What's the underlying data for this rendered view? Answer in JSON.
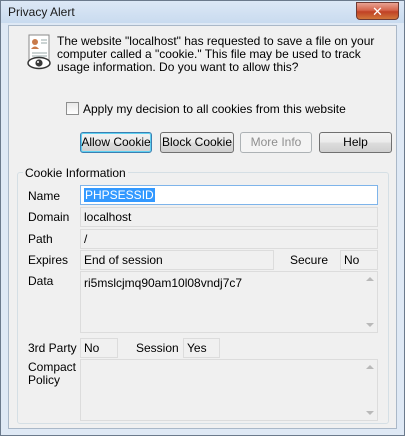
{
  "window": {
    "title": "Privacy Alert",
    "close_glyph": "✕"
  },
  "message": "The website \"localhost\" has requested to save a file on your computer called a \"cookie.\"  This file may be used to track usage information. Do you want to allow this?",
  "apply_checkbox": {
    "label": "Apply my decision to all cookies from this website",
    "checked": false
  },
  "buttons": {
    "allow": "Allow Cookie",
    "block": "Block Cookie",
    "more_info": "More Info",
    "help": "Help"
  },
  "cookie_info": {
    "group_title": "Cookie Information",
    "name_label": "Name",
    "name_value": "PHPSESSID",
    "domain_label": "Domain",
    "domain_value": "localhost",
    "path_label": "Path",
    "path_value": "/",
    "expires_label": "Expires",
    "expires_value": "End of session",
    "secure_label": "Secure",
    "secure_value": "No",
    "data_label": "Data",
    "data_value": "ri5mslcjmq90am10l08vndj7c7",
    "third_party_label": "3rd Party",
    "third_party_value": "No",
    "session_label": "Session",
    "session_value": "Yes",
    "compact_policy_label": "Compact Policy",
    "compact_policy_value": ""
  },
  "icons": {
    "alert": "privacy-eye-document-icon",
    "scroll_up": "scroll-up-arrow-icon",
    "scroll_down": "scroll-down-arrow-icon"
  }
}
